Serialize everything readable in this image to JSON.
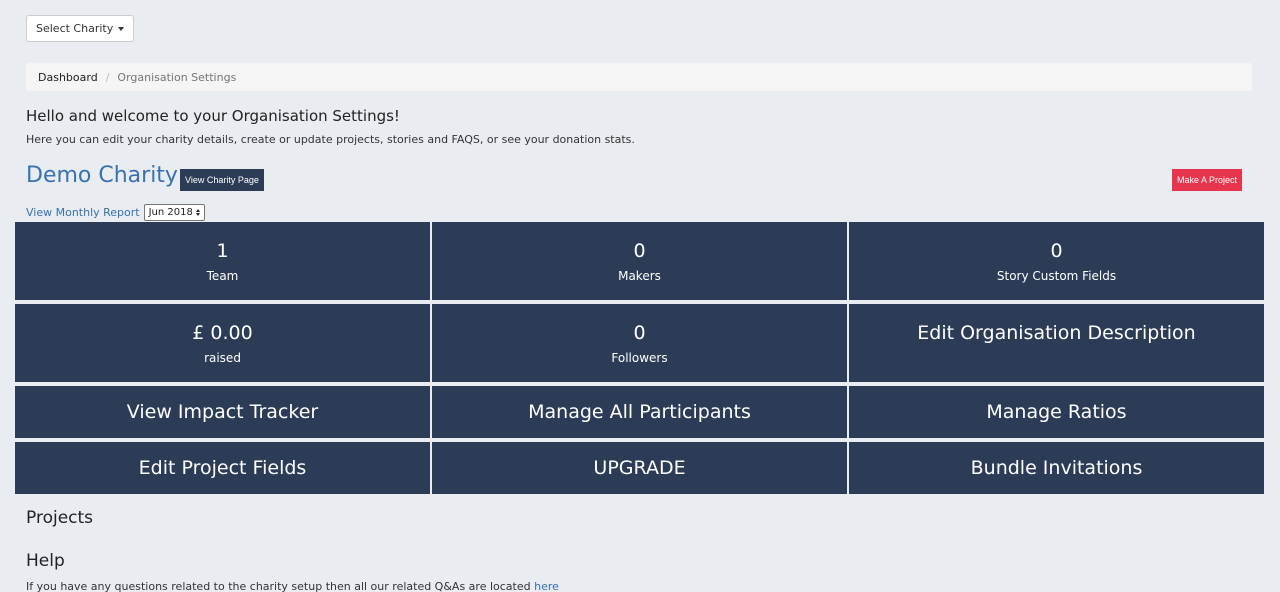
{
  "select_charity": {
    "label": "Select Charity"
  },
  "breadcrumb": {
    "home": "Dashboard",
    "separator": "/",
    "current": "Organisation Settings"
  },
  "welcome": {
    "title": "Hello and welcome to your Organisation Settings!",
    "text": "Here you can edit your charity details, create or update projects, stories and FAQS, or see your donation stats."
  },
  "charity": {
    "name": "Demo Charity",
    "view_page_label": "View Charity Page",
    "make_project_label": "Make A Project"
  },
  "report": {
    "link_label": "View Monthly Report",
    "selected_month": "Jun 2018"
  },
  "stats": [
    {
      "value": "1",
      "label": "Team"
    },
    {
      "value": "0",
      "label": "Makers"
    },
    {
      "value": "0",
      "label": "Story Custom Fields"
    },
    {
      "value": "£ 0.00",
      "label": "raised"
    },
    {
      "value": "0",
      "label": "Followers"
    }
  ],
  "actions": {
    "edit_description": "Edit Organisation Description",
    "impact_tracker": "View Impact Tracker",
    "manage_participants": "Manage All Participants",
    "manage_ratios": "Manage Ratios",
    "edit_project_fields": "Edit Project Fields",
    "upgrade": "UPGRADE",
    "bundle_invitations": "Bundle Invitations"
  },
  "projects": {
    "title": "Projects"
  },
  "help": {
    "title": "Help",
    "text": "If you have any questions related to the charity setup then all our related Q&As are located",
    "link_label": "here"
  },
  "colors": {
    "tile_bg": "#2c3c57",
    "accent_blue": "#3a72b0",
    "danger_red": "#e8354e",
    "page_bg": "#e9ecf1"
  }
}
